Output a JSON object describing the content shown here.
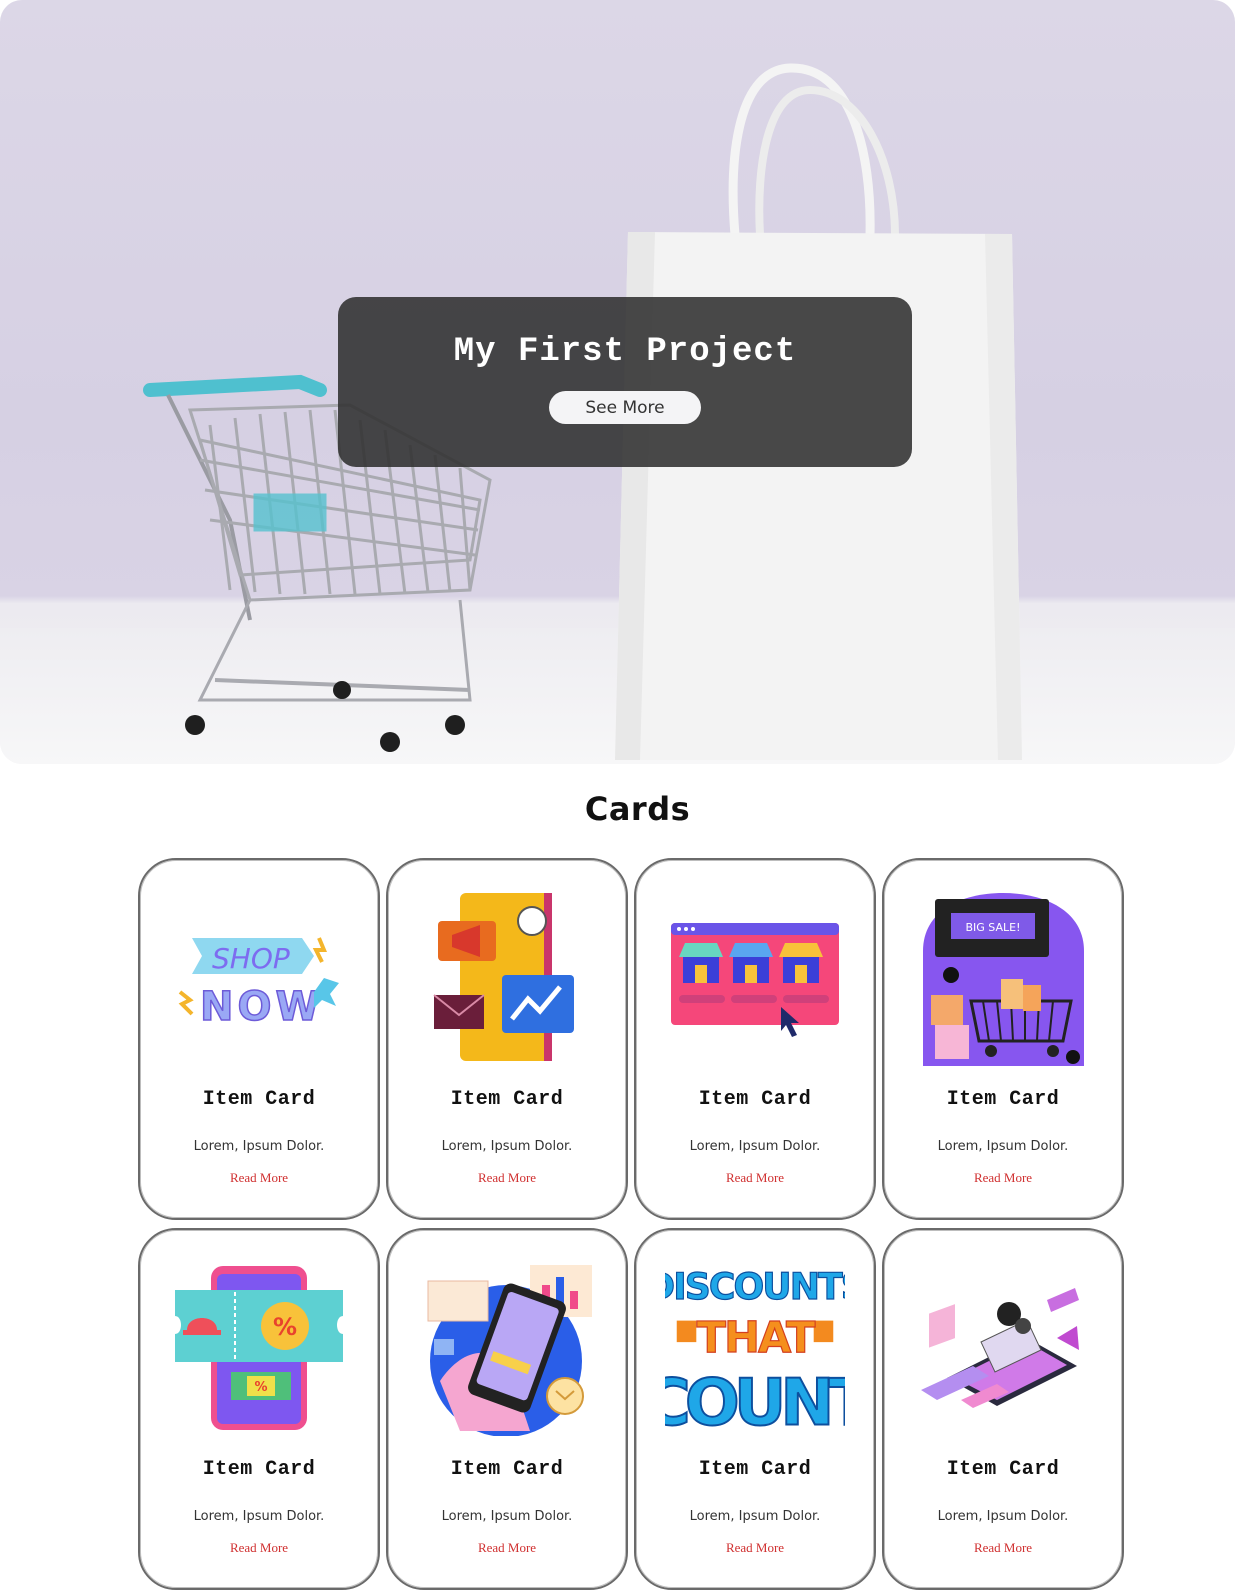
{
  "hero": {
    "title": "My First Project",
    "button_label": "See More"
  },
  "cards_section": {
    "heading": "Cards",
    "cards": [
      {
        "title": "Item Card",
        "description": "Lorem, Ipsum Dolor.",
        "link": "Read More",
        "image_words": [
          "SHOP",
          "NOW"
        ],
        "icon": "shop-now-illustration-icon"
      },
      {
        "title": "Item Card",
        "description": "Lorem, Ipsum Dolor.",
        "link": "Read More",
        "icon": "digital-marketing-phone-illustration-icon"
      },
      {
        "title": "Item Card",
        "description": "Lorem, Ipsum Dolor.",
        "link": "Read More",
        "icon": "online-store-browser-illustration-icon"
      },
      {
        "title": "Item Card",
        "description": "Lorem, Ipsum Dolor.",
        "link": "Read More",
        "image_words": [
          "BIG SALE!"
        ],
        "icon": "big-sale-cart-illustration-icon"
      },
      {
        "title": "Item Card",
        "description": "Lorem, Ipsum Dolor.",
        "link": "Read More",
        "image_words": [
          "%",
          "%"
        ],
        "icon": "coupon-phone-illustration-icon"
      },
      {
        "title": "Item Card",
        "description": "Lorem, Ipsum Dolor.",
        "link": "Read More",
        "icon": "mobile-shopping-illustration-icon"
      },
      {
        "title": "Item Card",
        "description": "Lorem, Ipsum Dolor.",
        "link": "Read More",
        "image_words": [
          "DISCOUNTS",
          "THAT",
          "COUNT"
        ],
        "icon": "discounts-that-count-lettering-icon"
      },
      {
        "title": "Item Card",
        "description": "Lorem, Ipsum Dolor.",
        "link": "Read More",
        "icon": "isometric-ecommerce-illustration-icon"
      }
    ]
  },
  "colors": {
    "hero_background": "#d8d2e5",
    "overlay": "#303030",
    "link": "#d03030",
    "card_border": "#6a6a6a"
  }
}
